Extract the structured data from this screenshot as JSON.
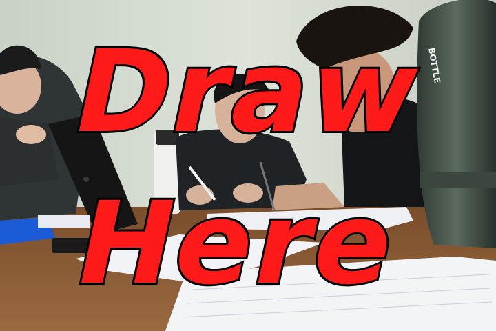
{
  "overlay": {
    "line1": "Draw",
    "line2": "Here",
    "text_color": "#ff1a1a",
    "outline_color": "#000000"
  },
  "bottle_label": "BOTTLE",
  "scene": {
    "wall_color": "#d6ddd3",
    "table_color": "#8a5a33",
    "paper_color": "#f3f4f6"
  }
}
